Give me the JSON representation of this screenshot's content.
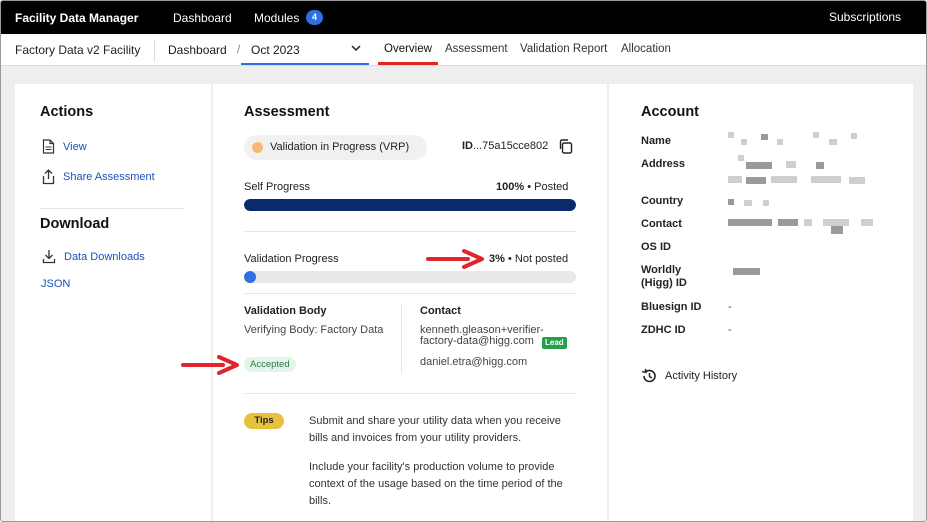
{
  "topbar": {
    "brand": "Facility Data Manager",
    "nav_dashboard": "Dashboard",
    "nav_modules": "Modules",
    "modules_count": "4",
    "subscriptions": "Subscriptions"
  },
  "subbar": {
    "facility": "Factory Data v2 Facility",
    "crumb_dashboard": "Dashboard",
    "crumb_separator": "/",
    "period": "Oct 2023",
    "tabs": [
      "Overview",
      "Assessment",
      "Validation Report",
      "Allocation"
    ],
    "active_tab": "Overview"
  },
  "actions": {
    "title": "Actions",
    "view": "View",
    "share": "Share Assessment",
    "download_title": "Download",
    "data_downloads": "Data Downloads",
    "json": "JSON"
  },
  "assessment": {
    "title": "Assessment",
    "status": "Validation in Progress (VRP)",
    "id_label": "ID",
    "id_value": "...75a15cce802",
    "self_progress_label": "Self Progress",
    "self_progress_pct": "100%",
    "self_progress_state": "Posted",
    "self_progress_value": 1.0,
    "validation_progress_label": "Validation Progress",
    "validation_progress_pct": "3%",
    "validation_progress_state": "Not posted",
    "validation_progress_value": 0.03,
    "dot": "•",
    "validation_body_label": "Validation Body",
    "validation_body_value": "Verifying Body: Factory Data",
    "accepted": "Accepted",
    "contact_label": "Contact",
    "contact_primary": "kenneth.gleason+verifier-factory-data@higg.com",
    "lead_badge": "Lead",
    "contact_secondary": "daniel.etra@higg.com",
    "tips_badge": "Tips",
    "tip_1": "Submit and share your utility data when you receive bills and invoices from your utility providers.",
    "tip_2": "Include your facility's production volume to provide context of the usage based on the time period of the bills."
  },
  "account": {
    "title": "Account",
    "name": "Name",
    "address": "Address",
    "country": "Country",
    "contact": "Contact",
    "os_id": "OS ID",
    "worldly_id": "Worldly (Higg) ID",
    "bluesign_id": "Bluesign ID",
    "bluesign_value": "-",
    "zdhc_id": "ZDHC ID",
    "zdhc_value": "-",
    "activity_history": "Activity History"
  },
  "colors": {
    "self_progress": "#0b2a6e",
    "validation_progress": "#2f6fe0",
    "accent_red": "#e0262a",
    "link": "#1f4fb8"
  }
}
